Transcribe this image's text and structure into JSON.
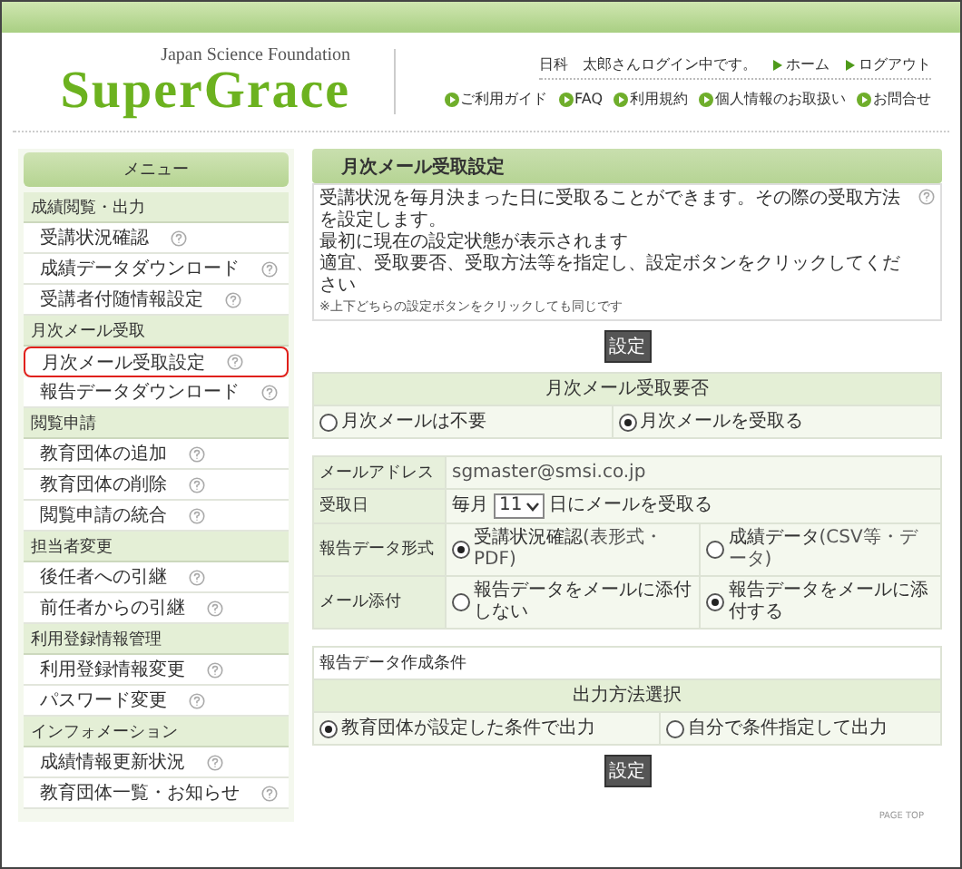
{
  "header": {
    "org": "Japan Science Foundation",
    "logo": "SuperGrace",
    "user": "日科　太郎さんログイン中です。",
    "top_links": [
      "ホーム",
      "ログアウト"
    ],
    "nav_links": [
      "ご利用ガイド",
      "FAQ",
      "利用規約",
      "個人情報のお取扱い",
      "お問合せ"
    ]
  },
  "sidebar": {
    "title": "メニュー",
    "sections": [
      {
        "label": "成績閲覧・出力",
        "items": [
          {
            "label": "受講状況確認",
            "selected": false
          },
          {
            "label": "成績データダウンロード",
            "selected": false
          },
          {
            "label": "受講者付随情報設定",
            "selected": false
          }
        ]
      },
      {
        "label": "月次メール受取",
        "items": [
          {
            "label": "月次メール受取設定",
            "selected": true
          },
          {
            "label": "報告データダウンロード",
            "selected": false
          }
        ]
      },
      {
        "label": "閲覧申請",
        "items": [
          {
            "label": "教育団体の追加",
            "selected": false
          },
          {
            "label": "教育団体の削除",
            "selected": false
          },
          {
            "label": "閲覧申請の統合",
            "selected": false
          }
        ]
      },
      {
        "label": "担当者変更",
        "items": [
          {
            "label": "後任者への引継",
            "selected": false
          },
          {
            "label": "前任者からの引継",
            "selected": false
          }
        ]
      },
      {
        "label": "利用登録情報管理",
        "items": [
          {
            "label": "利用登録情報変更",
            "selected": false
          },
          {
            "label": "パスワード変更",
            "selected": false
          }
        ]
      },
      {
        "label": "インフォメーション",
        "items": [
          {
            "label": "成績情報更新状況",
            "selected": false
          },
          {
            "label": "教育団体一覧・お知らせ",
            "selected": false
          }
        ]
      }
    ]
  },
  "main": {
    "title": "月次メール受取設定",
    "description": [
      "受講状況を毎月決まった日に受取ることができます。その際の受取方法を設定します。",
      "最初に現在の設定状態が表示されます",
      "適宜、受取要否、受取方法等を指定し、設定ボタンをクリックしてください"
    ],
    "note": "※上下どちらの設定ボタンをクリックしても同じです",
    "button_top": "設定",
    "receive": {
      "header": "月次メール受取要否",
      "options": [
        {
          "label": "月次メールは不要",
          "selected": false
        },
        {
          "label": "月次メールを受取る",
          "selected": true
        }
      ]
    },
    "settings": [
      {
        "kind": "text",
        "label": "メールアドレス",
        "value": "sgmaster@smsi.co.jp"
      },
      {
        "kind": "select",
        "label": "受取日",
        "prefix": "毎月",
        "value": "11",
        "suffix": "日にメールを受取る"
      },
      {
        "kind": "radio",
        "label": "報告データ形式",
        "options": [
          {
            "label": "受講状況確認",
            "note": "(表形式・PDF)",
            "selected": true
          },
          {
            "label": "成績データ",
            "note": "(CSV等・データ)",
            "selected": false
          }
        ]
      },
      {
        "kind": "radio",
        "label": "メール添付",
        "options": [
          {
            "label": "報告データをメールに添付しない",
            "selected": false
          },
          {
            "label": "報告データをメールに添付する",
            "selected": true
          }
        ]
      }
    ],
    "conditions": {
      "title": "報告データ作成条件",
      "header": "出力方法選択",
      "options": [
        {
          "label": "教育団体が設定した条件で出力",
          "selected": true
        },
        {
          "label": "自分で条件指定して出力",
          "selected": false
        }
      ]
    },
    "button_bottom": "設定",
    "page_top": "PAGE TOP"
  }
}
